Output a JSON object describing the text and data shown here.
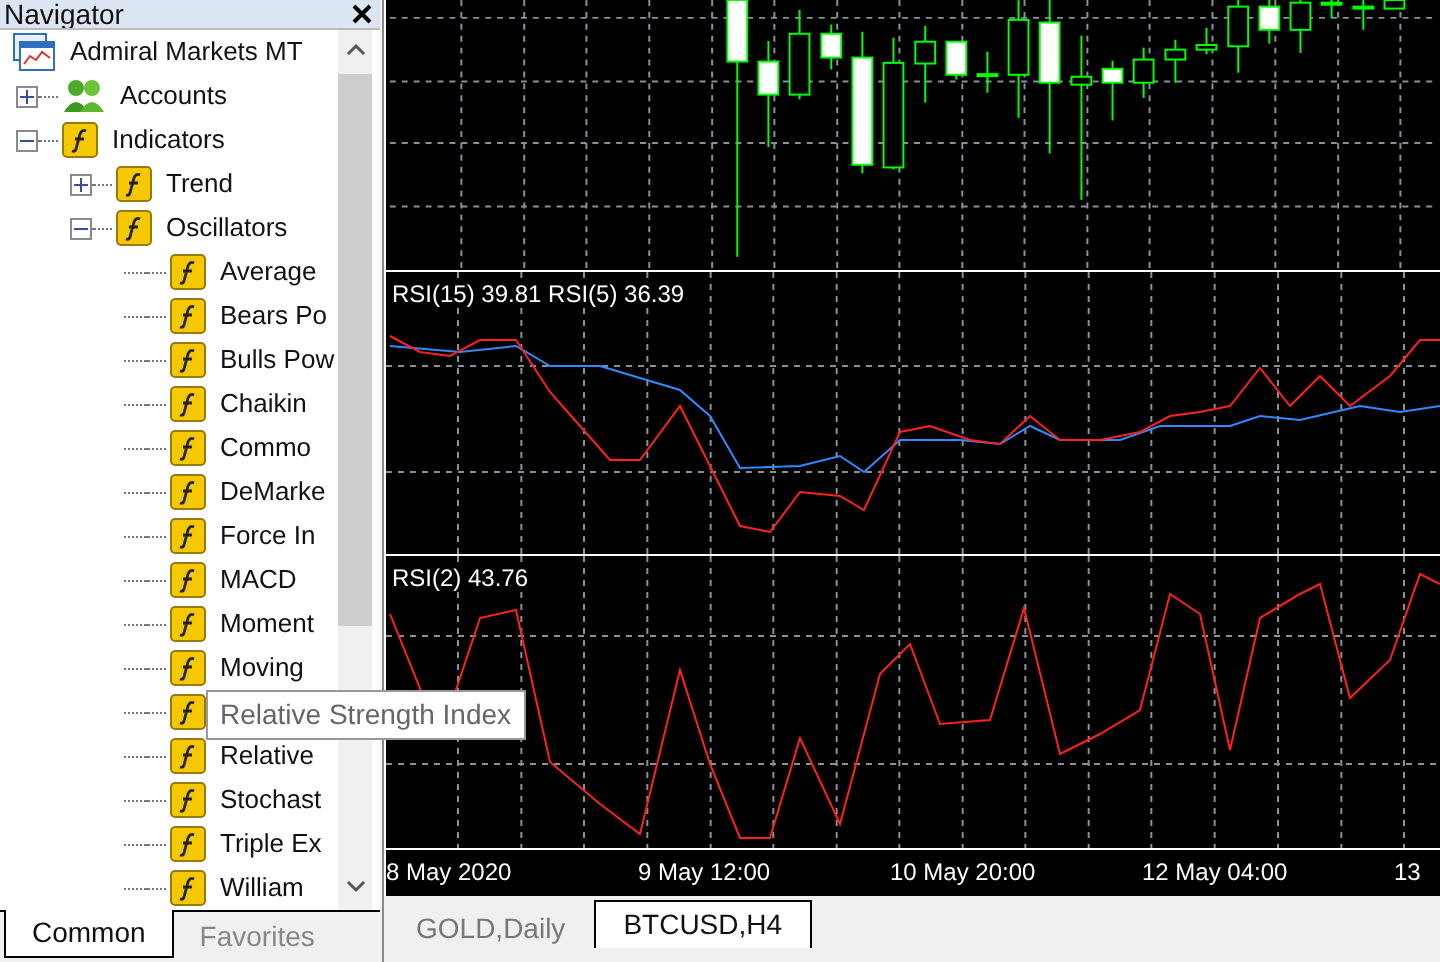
{
  "navigator": {
    "title": "Navigator",
    "tree": [
      {
        "label": "Admiral Markets MT",
        "kind": "terminal",
        "children": [
          {
            "label": "Accounts",
            "kind": "accounts",
            "expanded": false
          },
          {
            "label": "Indicators",
            "kind": "function",
            "expanded": true,
            "children": [
              {
                "label": "Trend",
                "kind": "function",
                "expanded": false
              },
              {
                "label": "Oscillators",
                "kind": "function",
                "expanded": true,
                "children": [
                  {
                    "label": "Average",
                    "kind": "function"
                  },
                  {
                    "label": "Bears Po",
                    "kind": "function"
                  },
                  {
                    "label": "Bulls Pow",
                    "kind": "function"
                  },
                  {
                    "label": "Chaikin",
                    "kind": "function"
                  },
                  {
                    "label": "Commo",
                    "kind": "function"
                  },
                  {
                    "label": "DeMarke",
                    "kind": "function"
                  },
                  {
                    "label": "Force In",
                    "kind": "function"
                  },
                  {
                    "label": "MACD",
                    "kind": "function"
                  },
                  {
                    "label": "Moment",
                    "kind": "function"
                  },
                  {
                    "label": "Moving",
                    "kind": "function"
                  },
                  {
                    "kind": "function"
                  },
                  {
                    "label": "Relative",
                    "kind": "function"
                  },
                  {
                    "label": "Stochast",
                    "kind": "function"
                  },
                  {
                    "label": "Triple Ex",
                    "kind": "function"
                  },
                  {
                    "label": "William",
                    "kind": "function"
                  }
                ]
              }
            ]
          }
        ]
      }
    ],
    "tooltip": "Relative Strength Index",
    "tabs": [
      {
        "label": "Common",
        "selected": true
      },
      {
        "label": "Favorites",
        "selected": false
      }
    ]
  },
  "chart": {
    "panels": [
      {
        "label": "RSI(15) 39.81 RSI(5) 36.39"
      },
      {
        "label": "RSI(2) 43.76"
      }
    ],
    "time_axis": [
      "8 May 2020",
      "9 May 12:00",
      "10 May 20:00",
      "12 May 04:00",
      "13"
    ],
    "tabs": [
      {
        "label": "GOLD,Daily",
        "selected": false
      },
      {
        "label": "BTCUSD,H4",
        "selected": true
      }
    ]
  }
}
